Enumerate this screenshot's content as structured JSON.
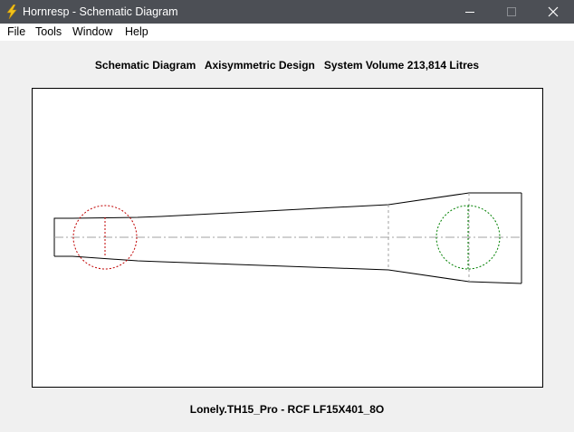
{
  "window": {
    "title": "Hornresp - Schematic Diagram",
    "app_icon": "lightning-bolt-icon",
    "controls": [
      "minimize-icon",
      "maximize-icon",
      "close-icon"
    ]
  },
  "menu": {
    "items": [
      "File",
      "Tools",
      "Window",
      "Help"
    ]
  },
  "diagram": {
    "heading": "Schematic Diagram   Axisymmetric Design   System Volume 213,814 Litres",
    "footer": "Lonely.TH15_Pro - RCF LF15X401_8O",
    "colors": {
      "outline": "#000000",
      "axis": "#a0a0a0",
      "driver_left": "#c00000",
      "driver_right": "#008000",
      "titlebar": "#4c4f55",
      "app_icon": "#f2c31a"
    }
  }
}
